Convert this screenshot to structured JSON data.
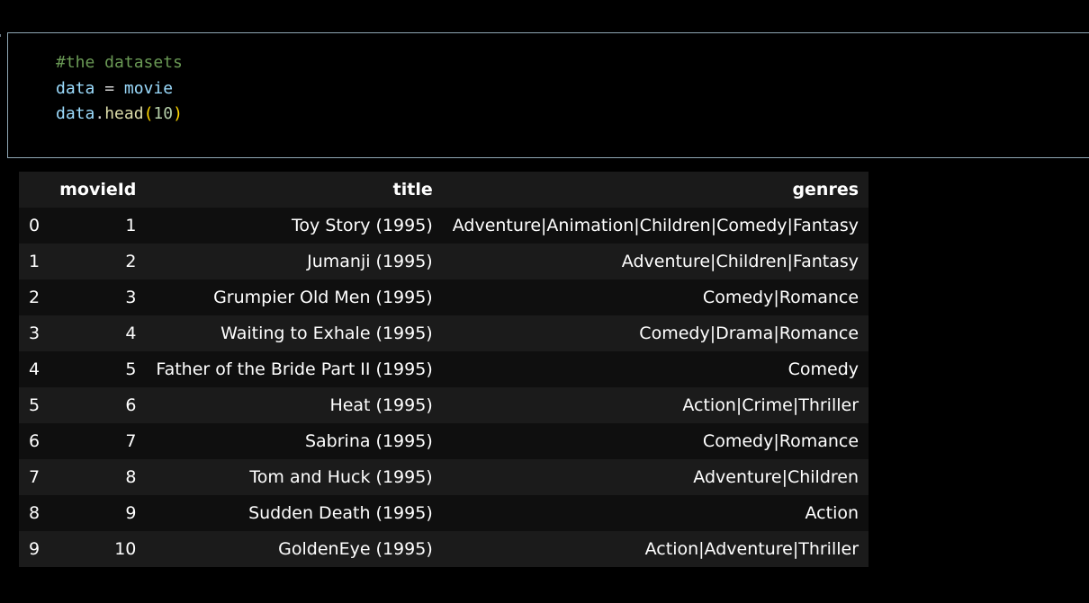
{
  "code_cell": {
    "lines": [
      [
        {
          "text": "#the datasets",
          "kind": "comment"
        }
      ],
      [
        {
          "text": "data",
          "kind": "var"
        },
        {
          "text": " = ",
          "kind": "op"
        },
        {
          "text": "movie",
          "kind": "var"
        }
      ],
      [
        {
          "text": "data",
          "kind": "var"
        },
        {
          "text": ".",
          "kind": "op"
        },
        {
          "text": "head",
          "kind": "func"
        },
        {
          "text": "(",
          "kind": "paren"
        },
        {
          "text": "10",
          "kind": "num"
        },
        {
          "text": ")",
          "kind": "paren"
        }
      ]
    ]
  },
  "output_table": {
    "columns": [
      "",
      "movieId",
      "title",
      "genres"
    ],
    "rows": [
      {
        "index": "0",
        "movieId": "1",
        "title": "Toy Story (1995)",
        "genres": "Adventure|Animation|Children|Comedy|Fantasy"
      },
      {
        "index": "1",
        "movieId": "2",
        "title": "Jumanji (1995)",
        "genres": "Adventure|Children|Fantasy"
      },
      {
        "index": "2",
        "movieId": "3",
        "title": "Grumpier Old Men (1995)",
        "genres": "Comedy|Romance"
      },
      {
        "index": "3",
        "movieId": "4",
        "title": "Waiting to Exhale (1995)",
        "genres": "Comedy|Drama|Romance"
      },
      {
        "index": "4",
        "movieId": "5",
        "title": "Father of the Bride Part II (1995)",
        "genres": "Comedy"
      },
      {
        "index": "5",
        "movieId": "6",
        "title": "Heat (1995)",
        "genres": "Action|Crime|Thriller"
      },
      {
        "index": "6",
        "movieId": "7",
        "title": "Sabrina (1995)",
        "genres": "Comedy|Romance"
      },
      {
        "index": "7",
        "movieId": "8",
        "title": "Tom and Huck (1995)",
        "genres": "Adventure|Children"
      },
      {
        "index": "8",
        "movieId": "9",
        "title": "Sudden Death (1995)",
        "genres": "Action"
      },
      {
        "index": "9",
        "movieId": "10",
        "title": "GoldenEye (1995)",
        "genres": "Action|Adventure|Thriller"
      }
    ]
  },
  "colors": {
    "background": "#000000",
    "cell_border": "#8fa7b4",
    "comment": "#6a9955",
    "variable": "#9cdcfe",
    "function": "#dcdcaa",
    "paren": "#ffd700",
    "number": "#b5cea8"
  }
}
